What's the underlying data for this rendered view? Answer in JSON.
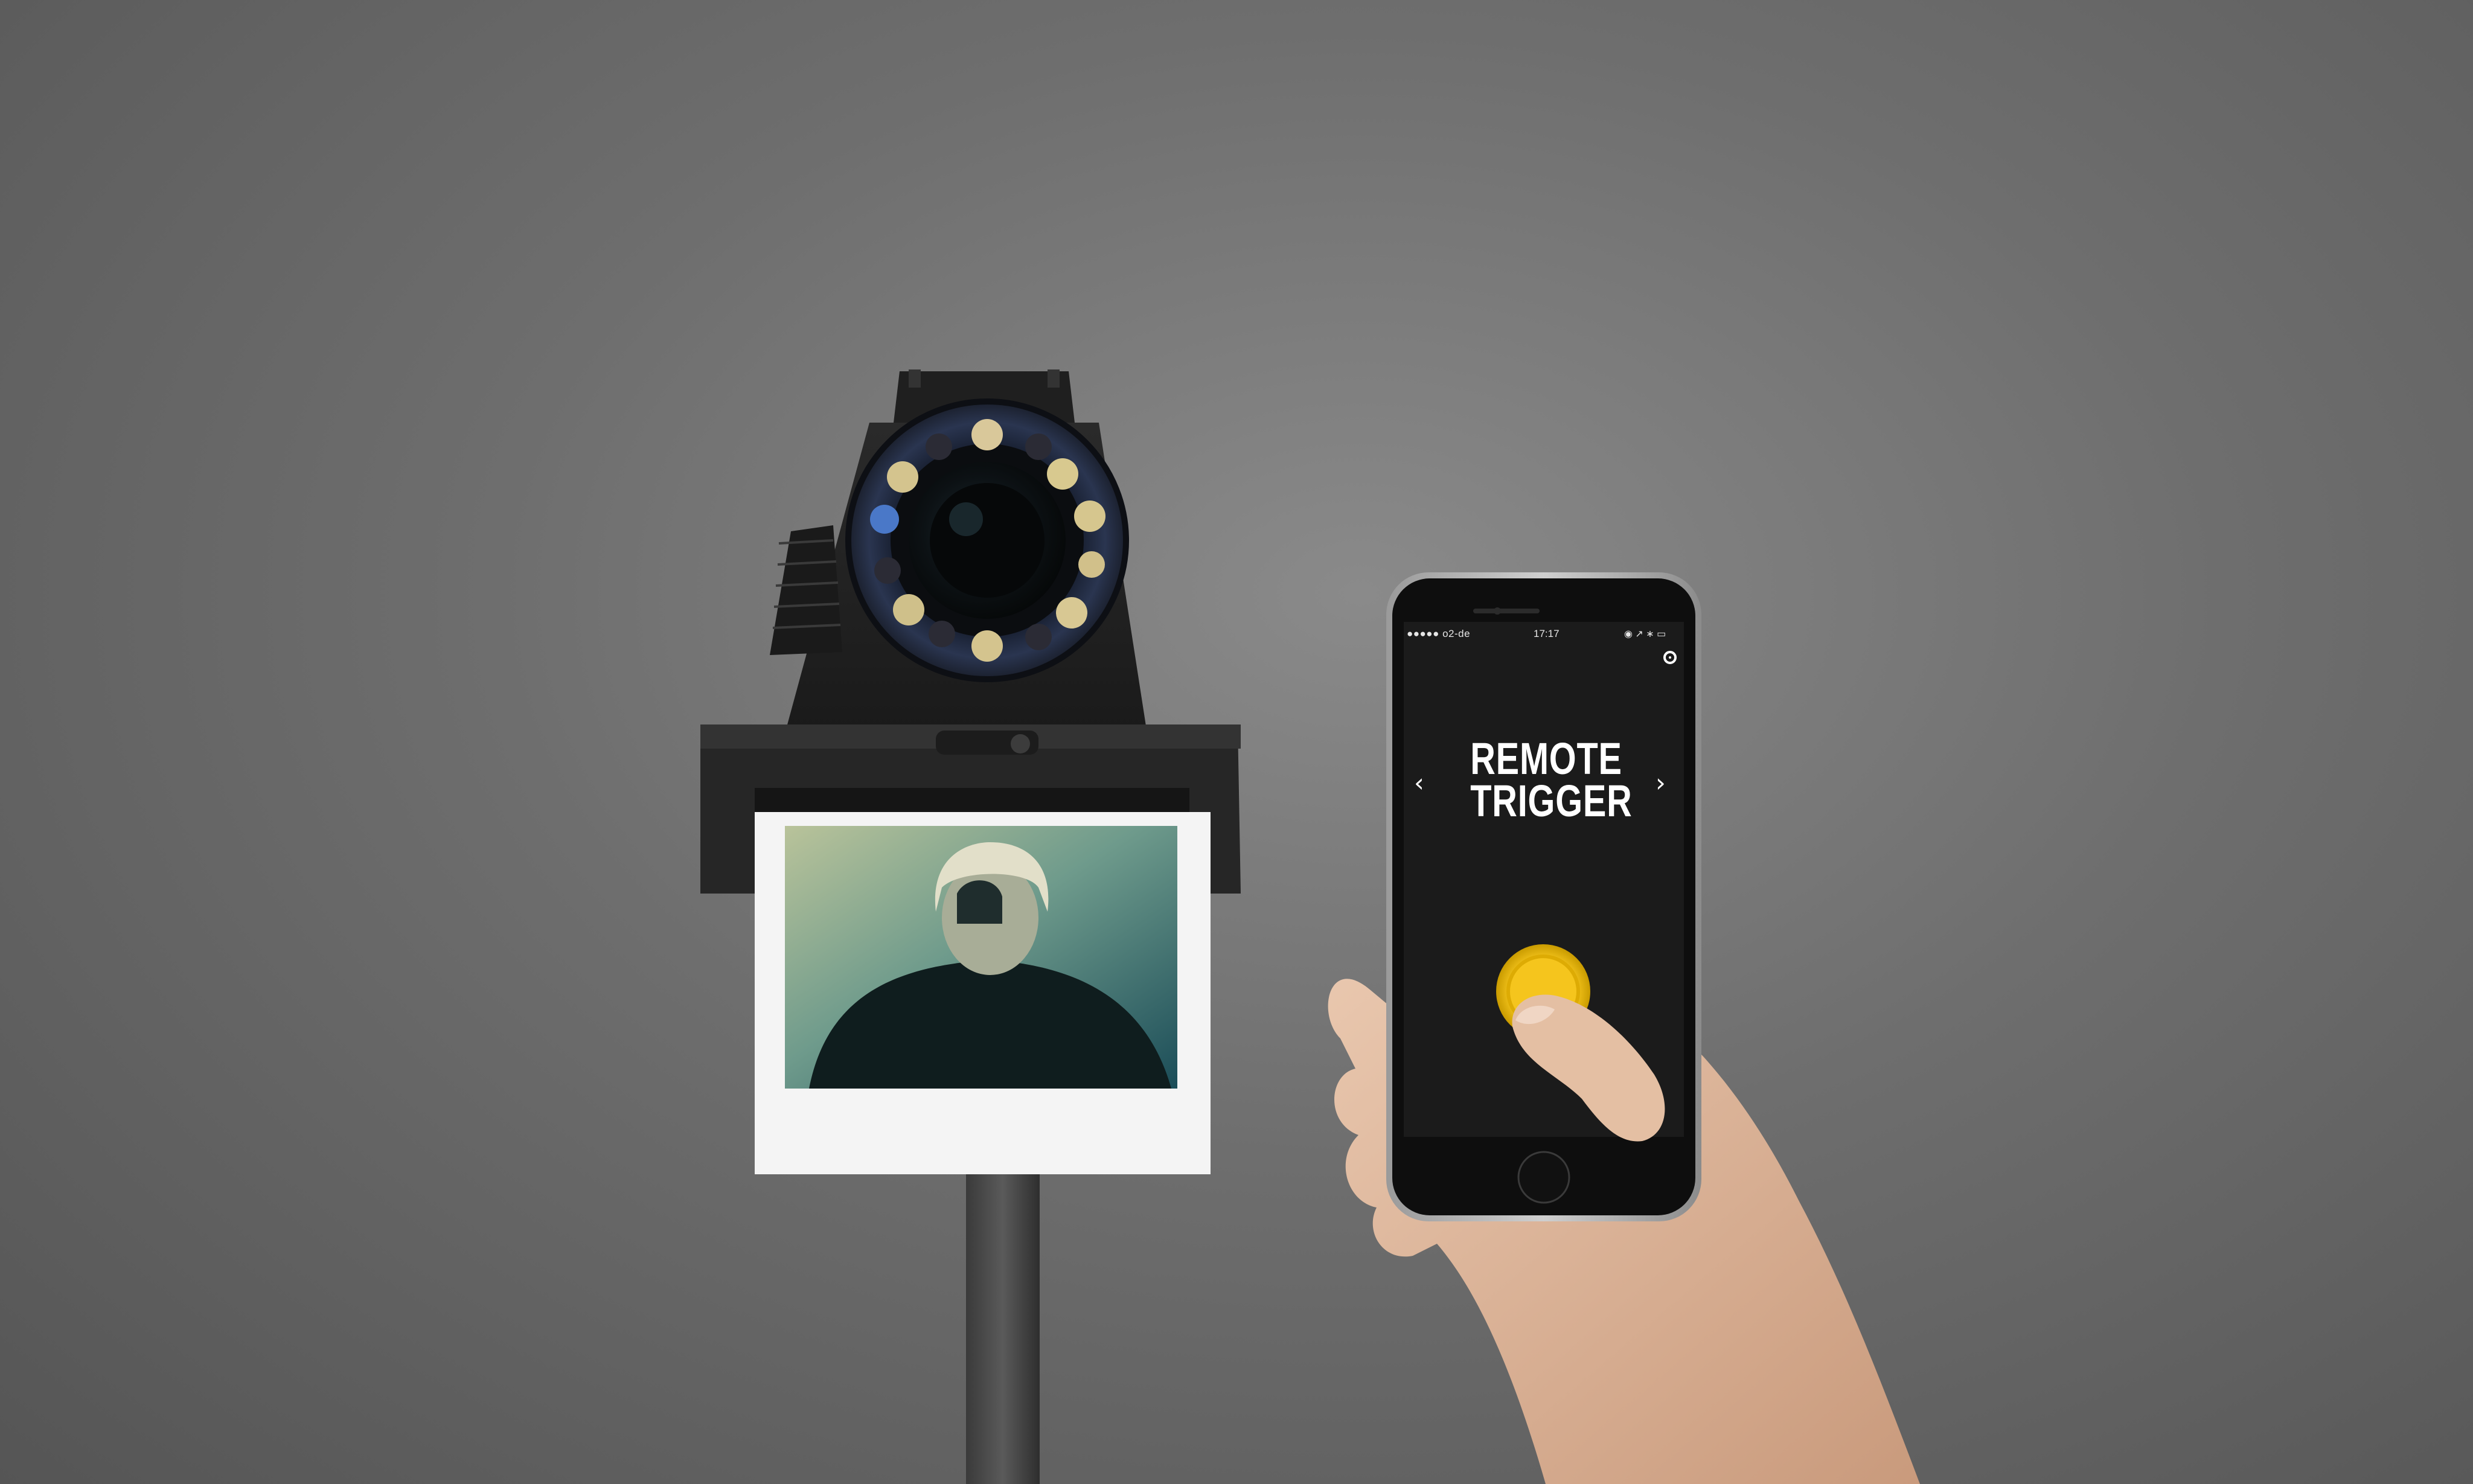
{
  "phone": {
    "carrier": "●●●●● o2-de ",
    "time": "17:17",
    "status_icons": "◉ ↗ ∗ ▭",
    "title_line1": "REMOTE",
    "title_line2": "TRIGGER",
    "prev_arrow": "‹",
    "next_arrow": "›",
    "trigger_color": "#f3c21a"
  },
  "icons": {
    "settings": "settings-icon",
    "prev": "chevron-left-icon",
    "next": "chevron-right-icon",
    "wifi": "wifi-icon"
  }
}
